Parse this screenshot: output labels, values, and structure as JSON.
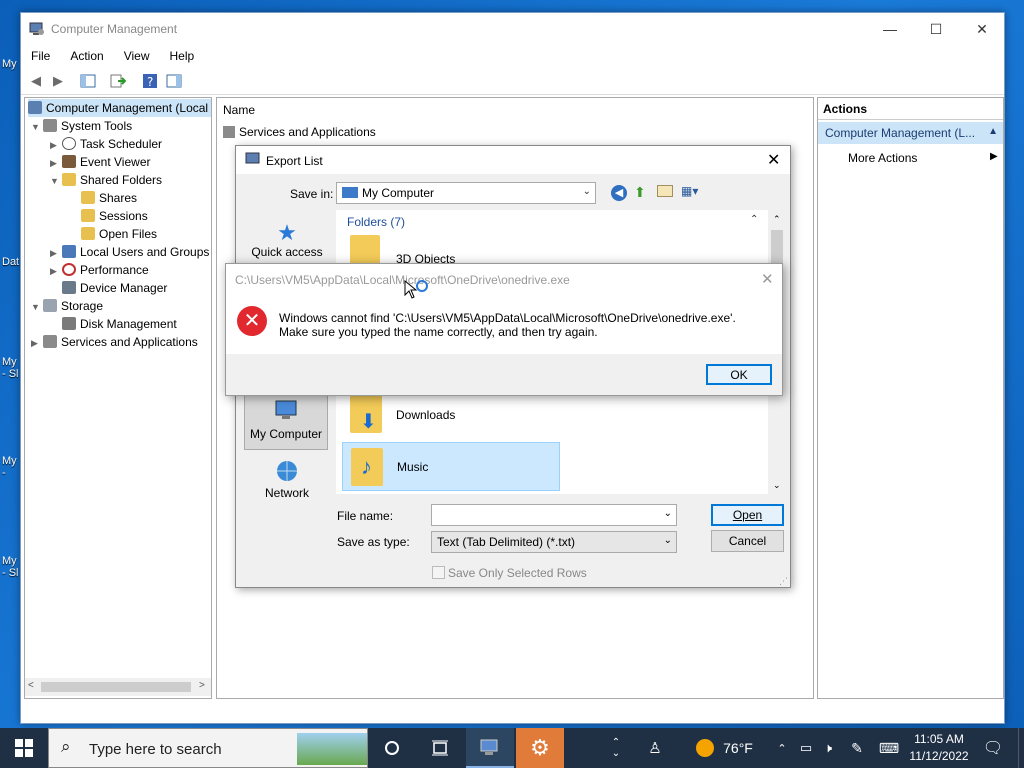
{
  "desktop": {
    "icons": [
      "My",
      "Dat",
      "My\n- Sl",
      "My\n-",
      "My\n- Sl"
    ]
  },
  "window": {
    "title": "Computer Management",
    "caption_buttons": {
      "minimize": "—",
      "maximize": "☐",
      "close": "✕"
    },
    "menu": [
      "File",
      "Action",
      "View",
      "Help"
    ]
  },
  "tree": {
    "root": "Computer Management (Local",
    "items": [
      {
        "label": "System Tools",
        "icon": "tools-icon"
      },
      {
        "label": "Task Scheduler",
        "icon": "clock-icon"
      },
      {
        "label": "Event Viewer",
        "icon": "event-viewer-icon"
      },
      {
        "label": "Shared Folders",
        "icon": "shared-folder-icon"
      },
      {
        "label": "Shares",
        "icon": "share-icon"
      },
      {
        "label": "Sessions",
        "icon": "session-icon"
      },
      {
        "label": "Open Files",
        "icon": "open-files-icon"
      },
      {
        "label": "Local Users and Groups",
        "icon": "users-icon"
      },
      {
        "label": "Performance",
        "icon": "performance-icon"
      },
      {
        "label": "Device Manager",
        "icon": "device-manager-icon"
      },
      {
        "label": "Storage",
        "icon": "storage-icon"
      },
      {
        "label": "Disk Management",
        "icon": "disk-icon"
      },
      {
        "label": "Services and Applications",
        "icon": "services-icon"
      }
    ]
  },
  "center": {
    "column_header": "Name",
    "rows": [
      "Services and Applications"
    ]
  },
  "actions": {
    "header": "Actions",
    "selected": "Computer Management (L...",
    "more": "More Actions"
  },
  "export_dialog": {
    "title": "Export List",
    "save_in_label": "Save in:",
    "save_in_value": "My Computer",
    "places": [
      "Quick access",
      "My Computer",
      "Network"
    ],
    "group_header": "Folders (7)",
    "folders": [
      "3D Objects",
      "Downloads",
      "Music"
    ],
    "file_name_label": "File name:",
    "file_name_value": "",
    "save_as_type_label": "Save as type:",
    "save_as_type_value": "Text (Tab Delimited) (*.txt)",
    "open_button": "Open",
    "cancel_button": "Cancel",
    "save_only_selected": "Save Only Selected Rows"
  },
  "error_dialog": {
    "title": "C:\\Users\\VM5\\AppData\\Local\\Microsoft\\OneDrive\\onedrive.exe",
    "message_line1": "Windows cannot find 'C:\\Users\\VM5\\AppData\\Local\\Microsoft\\OneDrive\\onedrive.exe'.",
    "message_line2": "Make sure you typed the name correctly, and then try again.",
    "ok_button": "OK"
  },
  "taskbar": {
    "search_placeholder": "Type here to search",
    "weather": "76°F",
    "time": "11:05 AM",
    "date": "11/12/2022"
  }
}
